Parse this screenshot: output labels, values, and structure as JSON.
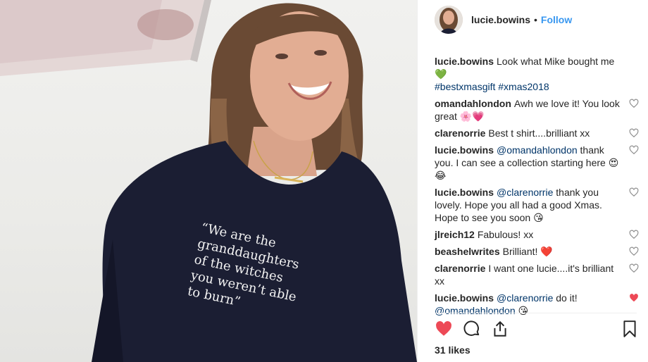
{
  "post": {
    "username": "lucie.bowins",
    "follow_label": "Follow",
    "likes": "31 likes",
    "shirt_text": "“We are the\ngranddaughters\nof the witches\nyou weren’t able\nto burn”"
  },
  "comments": [
    {
      "user": "lucie.bowins",
      "text": "Look what Mike bought me 💚",
      "tags": "#bestxmasgift #xmas2018",
      "liked": null
    },
    {
      "user": "omandahlondon",
      "text": "Awh we love it! You look great 🌸💗",
      "liked": false
    },
    {
      "user": "clarenorrie",
      "text": "Best t shirt....brilliant xx",
      "liked": false
    },
    {
      "user": "lucie.bowins",
      "mention": "@omandahlondon",
      "text": "thank you. I can see a collection starting here 😍😂",
      "liked": false
    },
    {
      "user": "lucie.bowins",
      "mention": "@clarenorrie",
      "text": "thank you lovely. Hope you all had a good Xmas. Hope to see you soon 😘",
      "liked": false
    },
    {
      "user": "jlreich12",
      "text": "Fabulous! xx",
      "liked": false
    },
    {
      "user": "beashelwrites",
      "text": "Brilliant! ❤️",
      "liked": false
    },
    {
      "user": "clarenorrie",
      "text": "I want one lucie....it's brilliant xx",
      "liked": false
    },
    {
      "user": "lucie.bowins",
      "mention": "@clarenorrie",
      "text": "do it!",
      "mention2": "@omandahlondon",
      "text2": "😘",
      "liked": true
    }
  ],
  "icons": {
    "like": "heart-icon",
    "comment": "comment-icon",
    "share": "share-icon",
    "save": "bookmark-icon"
  },
  "colors": {
    "liked": "#ed4956",
    "follow": "#3897f0",
    "link": "#003569"
  }
}
